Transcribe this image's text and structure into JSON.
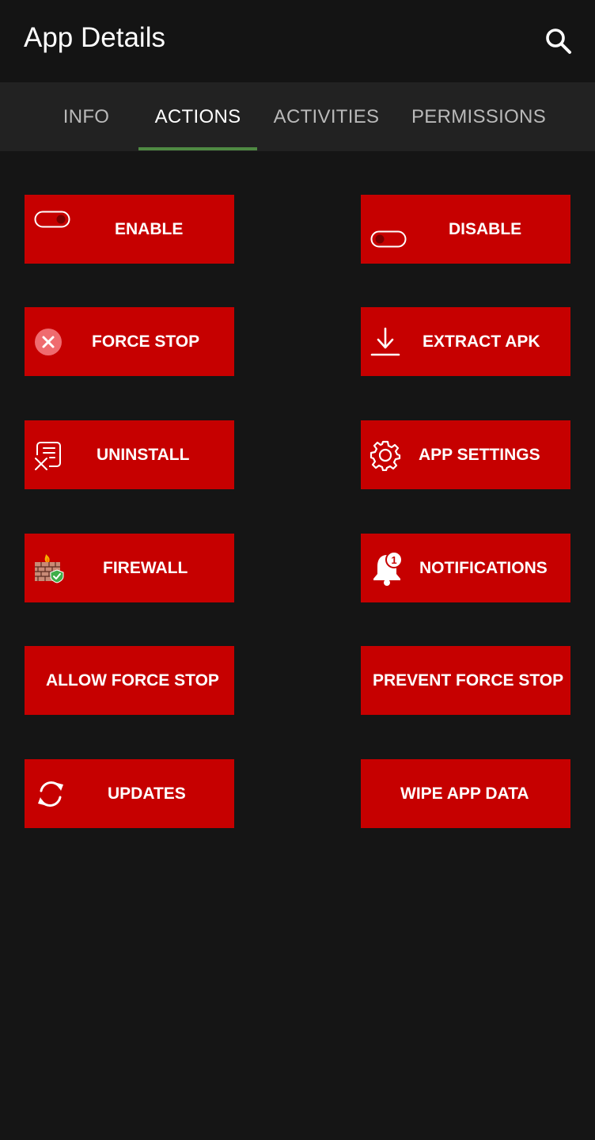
{
  "app_bar": {
    "title": "App Details",
    "search_icon": "search-icon"
  },
  "tabs": [
    {
      "label": "INFO",
      "active": false
    },
    {
      "label": "ACTIONS",
      "active": true
    },
    {
      "label": "ACTIVITIES",
      "active": false
    },
    {
      "label": "PERMISSIONS",
      "active": false
    }
  ],
  "colors": {
    "background": "#151515",
    "app_bar": "#141414",
    "tab_bar": "#222222",
    "tab_indicator": "#4f8a43",
    "button": "#c60000",
    "text": "#ffffff"
  },
  "actions": [
    {
      "label": "ENABLE",
      "icon": "toggle-off-icon"
    },
    {
      "label": "DISABLE",
      "icon": "toggle-on-icon"
    },
    {
      "label": "FORCE STOP",
      "icon": "close-circle-icon"
    },
    {
      "label": "EXTRACT APK",
      "icon": "download-icon"
    },
    {
      "label": "UNINSTALL",
      "icon": "uninstall-document-icon"
    },
    {
      "label": "APP SETTINGS",
      "icon": "gear-icon"
    },
    {
      "label": "FIREWALL",
      "icon": "firewall-icon"
    },
    {
      "label": "NOTIFICATIONS",
      "icon": "bell-badge-icon",
      "badge": "1"
    },
    {
      "label": "ALLOW FORCE STOP",
      "icon": ""
    },
    {
      "label": "PREVENT FORCE STOP",
      "icon": ""
    },
    {
      "label": "UPDATES",
      "icon": "refresh-icon"
    },
    {
      "label": "WIPE APP DATA",
      "icon": ""
    }
  ]
}
